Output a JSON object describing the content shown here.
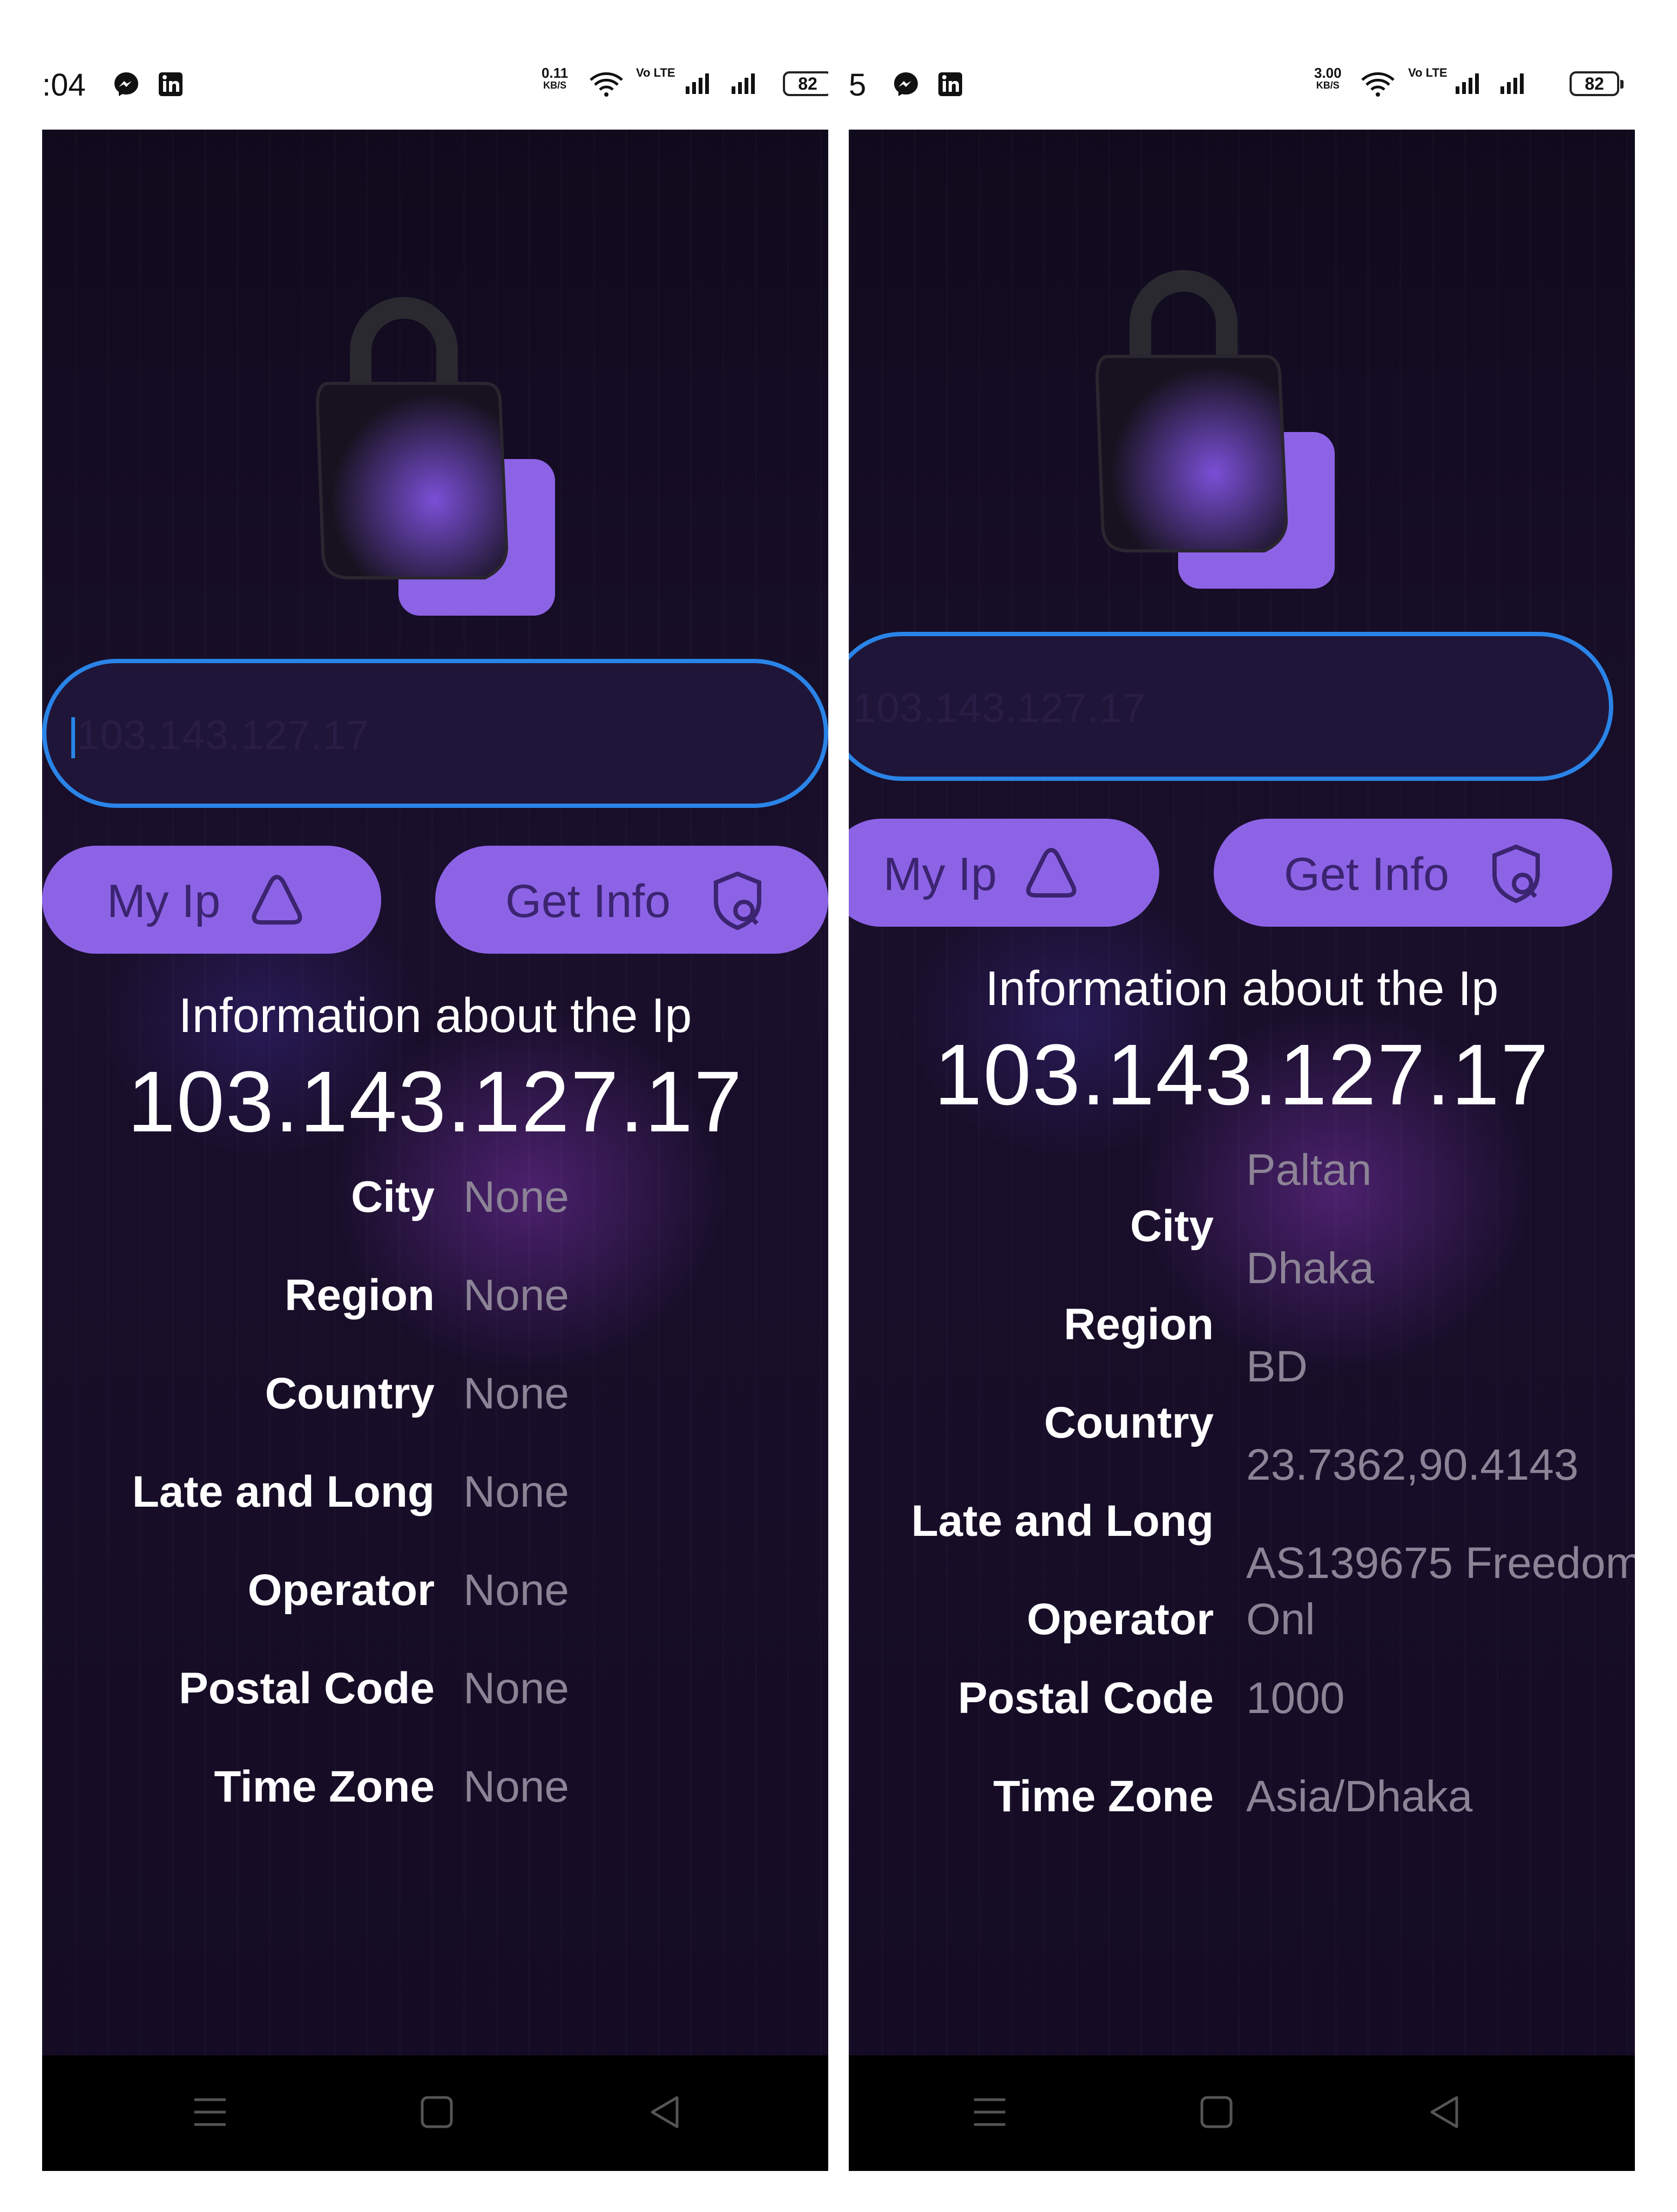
{
  "left_screen": {
    "status": {
      "time": ":04",
      "speed_value": "0.11",
      "speed_unit": "KB/S",
      "volte": "Vo LTE",
      "battery": "82"
    },
    "input": {
      "value": "103.143.127.17"
    },
    "buttons": {
      "my_ip": "My Ip",
      "get_info": "Get Info"
    },
    "info": {
      "title": "Information about the Ip",
      "ip": "103.143.127.17",
      "rows": [
        {
          "label": "City",
          "value": "None"
        },
        {
          "label": "Region",
          "value": "None"
        },
        {
          "label": "Country",
          "value": "None"
        },
        {
          "label": "Late and Long",
          "value": "None"
        },
        {
          "label": "Operator",
          "value": "None"
        },
        {
          "label": "Postal Code",
          "value": "None"
        },
        {
          "label": "Time Zone",
          "value": "None"
        }
      ]
    }
  },
  "right_screen": {
    "status": {
      "time": "5",
      "speed_value": "3.00",
      "speed_unit": "KB/S",
      "volte": "Vo LTE",
      "battery": "82"
    },
    "input": {
      "value": "103.143.127.17"
    },
    "buttons": {
      "my_ip": "My Ip",
      "get_info": "Get Info"
    },
    "info": {
      "title": "Information about the Ip",
      "ip": "103.143.127.17",
      "rows": [
        {
          "label": "City",
          "value": "Paltan"
        },
        {
          "label": "Region",
          "value": "Dhaka"
        },
        {
          "label": "Country",
          "value": "BD"
        },
        {
          "label": "Late and Long",
          "value": "23.7362,90.4143"
        },
        {
          "label": "Operator",
          "value": "AS139675 Freedom",
          "value_line2": "Onl"
        },
        {
          "label": "Postal Code",
          "value": "1000"
        },
        {
          "label": "Time Zone",
          "value": "Asia/Dhaka"
        }
      ]
    }
  },
  "icons": {
    "messenger": "messenger-icon",
    "linkedin": "linkedin-icon",
    "wifi": "wifi-icon",
    "signal": "signal-icon",
    "battery": "battery-icon",
    "lock": "lock-icon",
    "my_ip": "triangle-icon",
    "get_info": "shield-search-icon",
    "nav_menu": "menu-icon",
    "nav_home": "home-icon",
    "nav_back": "back-icon"
  },
  "colors": {
    "accent_purple": "#8d63e6",
    "input_border": "#2a84e8",
    "background": "#130a22",
    "value_gray": "#8c8396"
  }
}
